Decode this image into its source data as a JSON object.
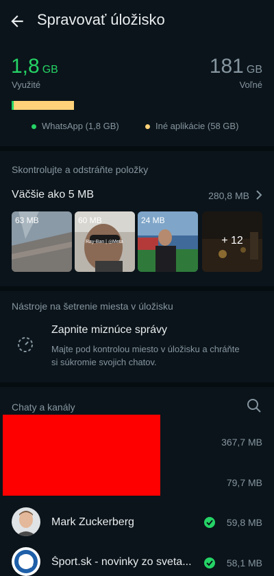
{
  "header": {
    "title": "Spravovať úložisko"
  },
  "storage": {
    "used_value": "1,8",
    "used_unit": "GB",
    "used_label": "Využité",
    "free_value": "181",
    "free_unit": "GB",
    "free_label": "Voľné",
    "whatsapp_fraction": 0.008,
    "other_apps_fraction": 0.24,
    "legend": [
      {
        "label": "WhatsApp (1,8 GB)",
        "color": "#25d366"
      },
      {
        "label": "Iné aplikácie (58 GB)",
        "color": "#ffd279"
      }
    ]
  },
  "review": {
    "heading": "Skontrolujte a odstráňte položky",
    "larger_title": "Väčšie ako 5 MB",
    "larger_size": "280,8 MB",
    "thumbnails": [
      {
        "label": "63 MB"
      },
      {
        "label": "60 MB",
        "watermark": "Ray-Ban | ◎Meta"
      },
      {
        "label": "24 MB"
      },
      {
        "label": "",
        "more": "+ 12"
      }
    ]
  },
  "tools": {
    "heading": "Nástroje na šetrenie miesta v úložisku",
    "title": "Zapnite miznúce správy",
    "description": "Majte pod kontrolou miesto v úložisku a chráňte si súkromie svojich chatov."
  },
  "chats": {
    "heading": "Chaty a kanály",
    "items": [
      {
        "name": "",
        "size": "367,7 MB",
        "redacted": true
      },
      {
        "name": "",
        "size": "79,7 MB",
        "redacted": true
      },
      {
        "name": "Mark Zuckerberg",
        "size": "59,8 MB",
        "verified": true
      },
      {
        "name": "Šport.sk - novinky zo sveta...",
        "size": "58,1 MB",
        "verified": true
      }
    ]
  },
  "colors": {
    "accent": "#25d366",
    "other_apps": "#ffd279",
    "background": "#0b141a"
  },
  "icons": [
    "back-arrow-icon",
    "chevron-right-icon",
    "timer-icon",
    "search-icon",
    "verified-check-icon"
  ]
}
